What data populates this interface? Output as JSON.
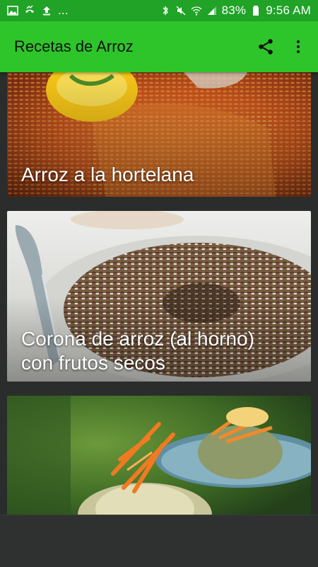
{
  "status_bar": {
    "left_icons": [
      "image-icon",
      "missed-call-icon",
      "upload-icon",
      "more-dots"
    ],
    "more_indicator": "...",
    "right_icons": [
      "bluetooth-icon",
      "mute-icon",
      "wifi-icon",
      "signal-icon",
      "battery-icon"
    ],
    "battery_percent": "83%",
    "time": "9:56 AM"
  },
  "app_bar": {
    "title": "Recetas de Arroz",
    "share_icon": "share-icon",
    "menu_icon": "overflow-menu-icon",
    "colors": {
      "bar": "#2ec52b",
      "status": "#20a327"
    }
  },
  "recipes": [
    {
      "title": "Arroz a la hortelana"
    },
    {
      "title_line1": "Corona de arroz (al horno)",
      "title_line2": "con frutos secos"
    },
    {
      "title": ""
    }
  ]
}
